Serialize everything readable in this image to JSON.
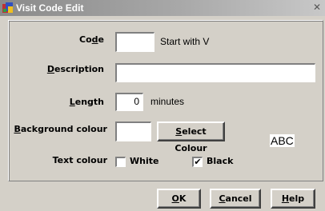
{
  "window": {
    "title": "Visit Code Edit",
    "close_symbol": "✕"
  },
  "code": {
    "label_pre": "Co",
    "label_u": "d",
    "label_post": "e",
    "value": "",
    "hint": "Start with V"
  },
  "description": {
    "label_u": "D",
    "label_post": "escription",
    "value": ""
  },
  "length": {
    "label_u": "L",
    "label_post": "ength",
    "value": "0",
    "unit": "minutes"
  },
  "background": {
    "label_u": "B",
    "label_post": "ackground colour",
    "swatch_color": "#ffffff",
    "button_u": "S",
    "button_post": "elect Colour"
  },
  "preview": {
    "text": "ABC"
  },
  "text_colour": {
    "label": "Text colour",
    "white": {
      "label": "White",
      "checked": false
    },
    "black": {
      "label": "Black",
      "checked": true,
      "mark": "✔"
    }
  },
  "buttons": {
    "ok": {
      "u": "O",
      "post": "K"
    },
    "cancel": {
      "u": "C",
      "post": "ancel"
    },
    "help": {
      "u": "H",
      "post": "elp"
    }
  }
}
